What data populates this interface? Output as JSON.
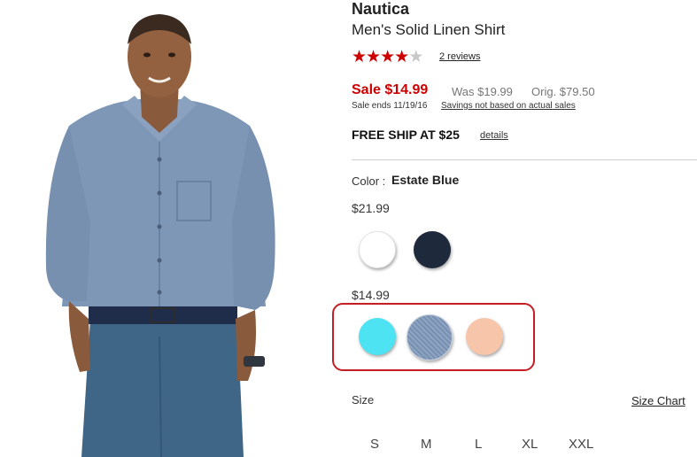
{
  "product": {
    "brand": "Nautica",
    "title": "Men's Solid Linen Shirt",
    "rating": {
      "value": 4,
      "max": 5,
      "reviews_label": "2 reviews"
    },
    "pricing": {
      "sale_label": "Sale $14.99",
      "was_label": "Was $19.99",
      "orig_label": "Orig. $79.50",
      "sale_ends": "Sale ends 11/19/16",
      "savings_link": "Savings not based on actual sales"
    },
    "shipping": {
      "label": "FREE SHIP AT $25",
      "details_link": "details"
    }
  },
  "color": {
    "label": "Color :",
    "selected": "Estate Blue",
    "groups": [
      {
        "price": "$21.99",
        "swatches": [
          {
            "name": "white",
            "hex": "#ffffff"
          },
          {
            "name": "navy",
            "hex": "#1e2a3c"
          }
        ]
      },
      {
        "price": "$14.99",
        "swatches": [
          {
            "name": "aqua",
            "hex": "#4de3f2"
          },
          {
            "name": "estate-blue",
            "hex": "#8ea4c2"
          },
          {
            "name": "peach",
            "hex": "#f7c6aa"
          }
        ]
      }
    ]
  },
  "size": {
    "label": "Size",
    "chart_link": "Size Chart",
    "options": [
      "S",
      "M",
      "L",
      "XL",
      "XXL"
    ]
  },
  "colors": {
    "sale_red": "#cc0000",
    "highlight_red": "#c41e24"
  }
}
